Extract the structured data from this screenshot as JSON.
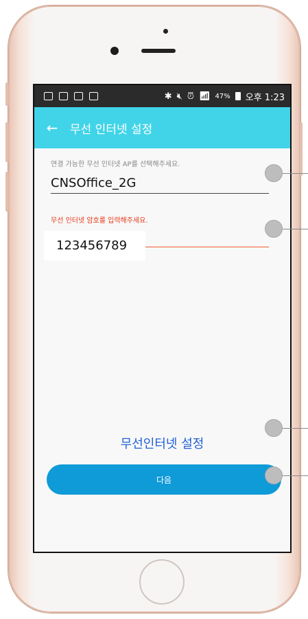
{
  "status_bar": {
    "left_icons": [
      "message-icon",
      "notes-icon",
      "gmail-icon",
      "gallery-icon"
    ],
    "bluetooth": "✱",
    "signal_text": "⦦",
    "battery_percent": "47%",
    "time": "오후 1:23"
  },
  "app_bar": {
    "back_glyph": "←",
    "title": "무선 인터넷 설정"
  },
  "form": {
    "ssid_label": "연결 가능한 무선 인터넷 AP를 선택해주세요.",
    "ssid_value": "CNSOffice_2G",
    "password_label": "무선 인터넷 암호를 입력해주세요.",
    "password_value": "123456789"
  },
  "wifi_settings_link": "무선인터넷 설정",
  "next_button": "다음",
  "colors": {
    "app_bar": "#41d4e8",
    "button": "#0f9ad8",
    "error": "#e8381a",
    "link": "#1f5fd6"
  }
}
